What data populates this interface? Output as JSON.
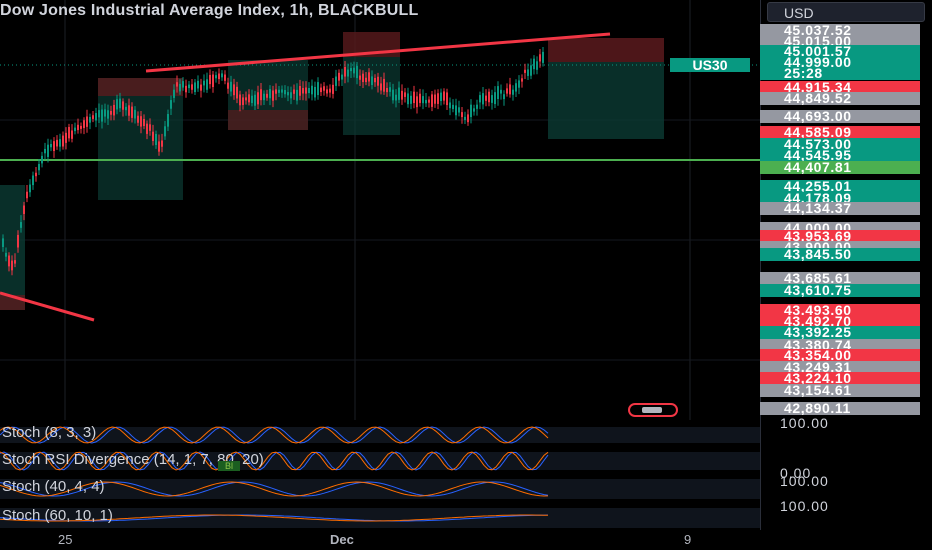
{
  "header": {
    "title": "Dow Jones Industrial Average Index, 1h, BLACKBULL"
  },
  "currency": "USD",
  "symbol_tag": "US30",
  "price_labels": [
    {
      "text": "45,037.52",
      "bg": "#9598a1"
    },
    {
      "text": "45,015.00",
      "bg": "#9598a1"
    },
    {
      "text": "45,001.57",
      "bg": "#089981"
    },
    {
      "text": "44,999.00",
      "bg": "#089981"
    },
    {
      "text": "25:28",
      "bg": "#089981"
    },
    {
      "text": "44,915.34",
      "bg": "#f23645"
    },
    {
      "text": "44,849.52",
      "bg": "#9598a1"
    },
    {
      "text": "44,693.00",
      "bg": "#9598a1"
    },
    {
      "text": "44,585.09",
      "bg": "#f23645"
    },
    {
      "text": "44,573.00",
      "bg": "#089981"
    },
    {
      "text": "44,545.95",
      "bg": "#089981"
    },
    {
      "text": "44,407.81",
      "bg": "#4caf50"
    },
    {
      "text": "44,255.01",
      "bg": "#089981"
    },
    {
      "text": "44,178.09",
      "bg": "#089981"
    },
    {
      "text": "44,134.37",
      "bg": "#9598a1"
    },
    {
      "text": "44,000.00",
      "bg": "#9598a1"
    },
    {
      "text": "43,953.69",
      "bg": "#f23645"
    },
    {
      "text": "43,900.00",
      "bg": "#9598a1"
    },
    {
      "text": "43,845.50",
      "bg": "#089981"
    },
    {
      "text": "43,685.61",
      "bg": "#9598a1"
    },
    {
      "text": "43,610.75",
      "bg": "#089981"
    },
    {
      "text": "43,493.60",
      "bg": "#f23645"
    },
    {
      "text": "43,492.70",
      "bg": "#f23645"
    },
    {
      "text": "43,392.25",
      "bg": "#089981"
    },
    {
      "text": "43,380.74",
      "bg": "#9598a1"
    },
    {
      "text": "43,354.00",
      "bg": "#f23645"
    },
    {
      "text": "43,249.31",
      "bg": "#9598a1"
    },
    {
      "text": "43,224.10",
      "bg": "#f23645"
    },
    {
      "text": "43,154.61",
      "bg": "#9598a1"
    },
    {
      "text": "42,890.11",
      "bg": "#9598a1"
    }
  ],
  "indicators": [
    {
      "title": "Stoch (8, 3, 3)",
      "value": "100.00"
    },
    {
      "title": "Stoch RSI Divergence (14, 1, 7, 80, 20)",
      "value": "0.00",
      "tag": "Bl"
    },
    {
      "title": "Stoch (40, 4, 4)",
      "value": "100.00"
    },
    {
      "title": "Stoch (60, 10, 1)",
      "value": "100.00"
    }
  ],
  "time_labels": [
    "25",
    "Dec",
    "9"
  ],
  "colors": {
    "up": "#089981",
    "down": "#f23645",
    "trendline": "#f23645",
    "support": "#4caf50"
  }
}
